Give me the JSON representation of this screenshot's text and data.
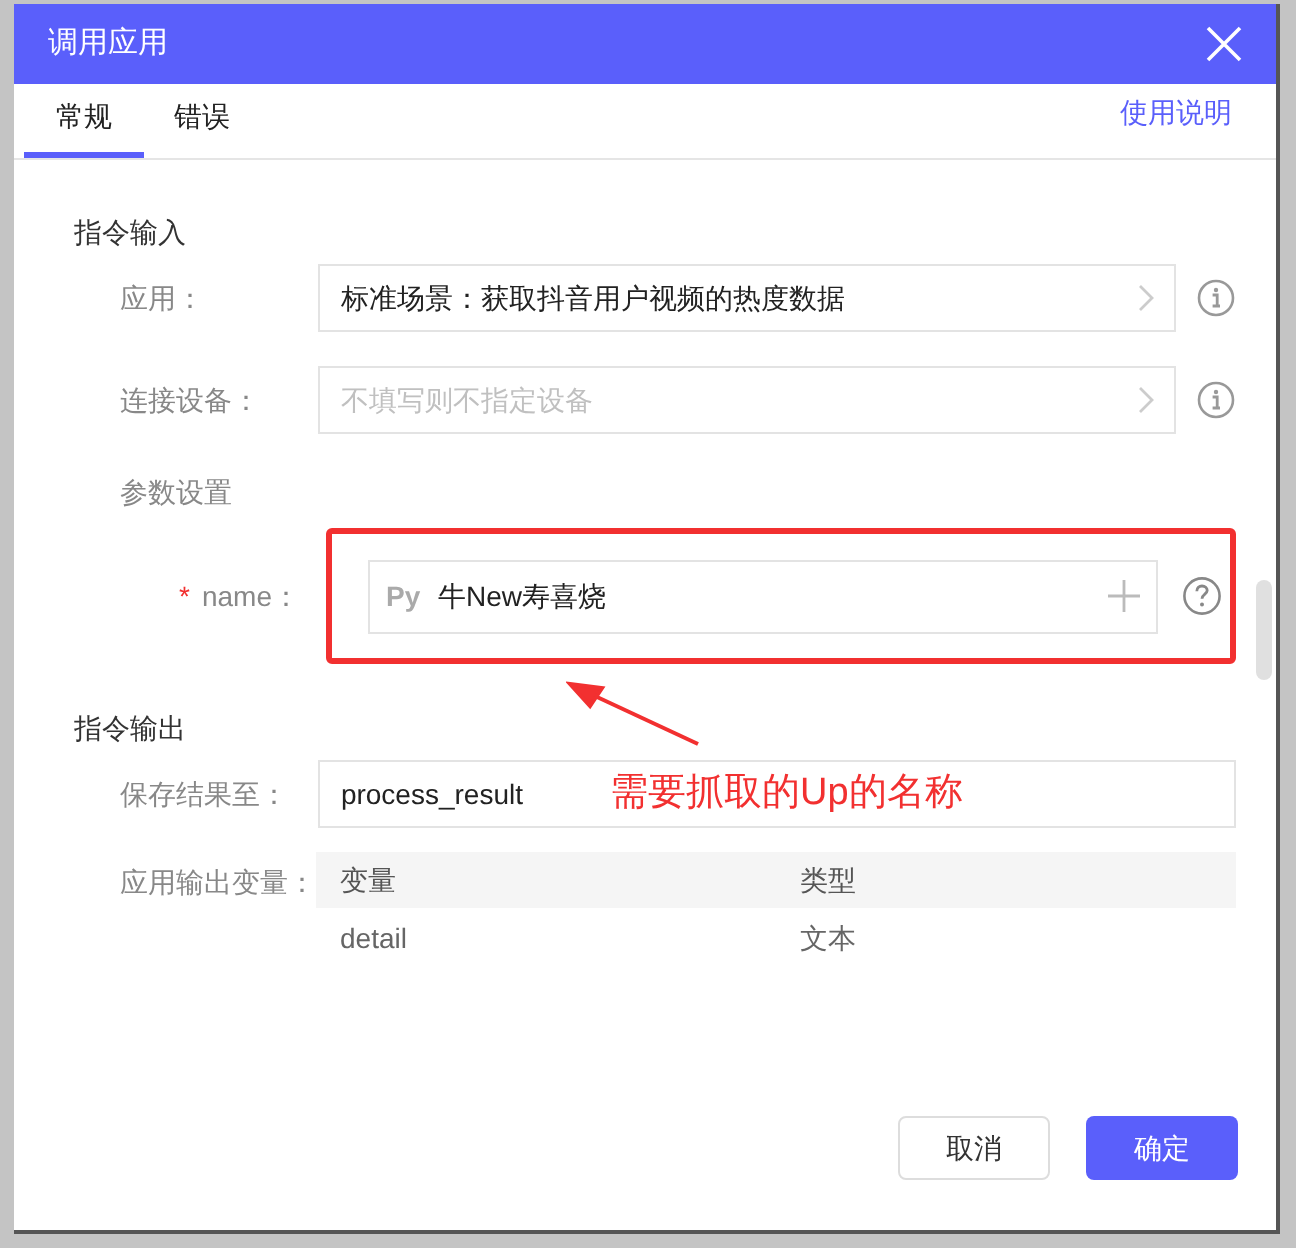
{
  "window": {
    "title": "调用应用"
  },
  "tabs": [
    {
      "label": "常规",
      "selected": true
    },
    {
      "label": "错误",
      "selected": false
    }
  ],
  "help_link": "使用说明",
  "input_section": {
    "title": "指令输入",
    "fields": [
      {
        "label": "应用：",
        "value": "标准场景：获取抖音用户视频的热度数据"
      },
      {
        "label": "连接设备：",
        "placeholder": "不填写则不指定设备"
      }
    ],
    "params_title": "参数设置",
    "params": [
      {
        "name": "name：",
        "required_mark": "*",
        "prefix": "Py",
        "value": "牛New寿喜烧"
      }
    ]
  },
  "output_section": {
    "title": "指令输出",
    "save_label": "保存结果至：",
    "save_value": "process_result",
    "vars_label": "应用输出变量：",
    "columns": [
      "变量",
      "类型"
    ],
    "rows": [
      [
        "detail",
        "文本"
      ]
    ]
  },
  "buttons": [
    {
      "label": "取消",
      "primary": false
    },
    {
      "label": "确定",
      "primary": true
    }
  ],
  "annotation": {
    "text": "需要抓取的Up的名称"
  }
}
